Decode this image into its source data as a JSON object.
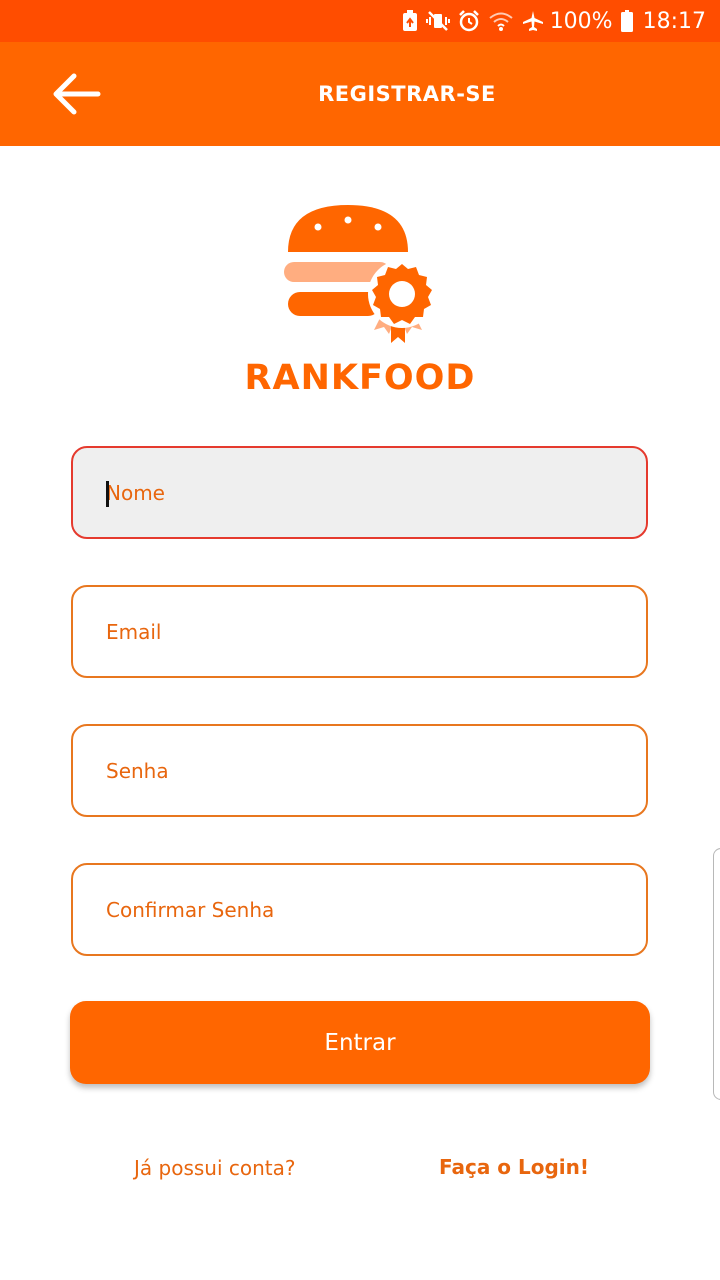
{
  "status_bar": {
    "battery_percent": "100%",
    "time": "18:17",
    "icons": [
      "battery-saver-icon",
      "mute-vibrate-icon",
      "alarm-icon",
      "wifi-icon",
      "airplane-mode-icon",
      "battery-icon"
    ]
  },
  "app_bar": {
    "title": "REGISTRAR-SE",
    "back_icon": "arrow-left-icon"
  },
  "brand": {
    "name": "RANKFOOD",
    "logo_icon": "burger-badge-icon"
  },
  "form": {
    "fields": [
      {
        "placeholder": "Nome",
        "value": "",
        "focused": true
      },
      {
        "placeholder": "Email",
        "value": "",
        "focused": false
      },
      {
        "placeholder": "Senha",
        "value": "",
        "focused": false
      },
      {
        "placeholder": "Confirmar Senha",
        "value": "",
        "focused": false
      }
    ],
    "submit_label": "Entrar"
  },
  "footer": {
    "question": "Já possui conta?",
    "login_link": "Faça o Login!"
  },
  "colors": {
    "status_bar": "#ff4d00",
    "primary": "#ff6600",
    "text_accent": "#e8660e",
    "focus_border": "#e53a2e",
    "logo_light": "#ffad80"
  }
}
